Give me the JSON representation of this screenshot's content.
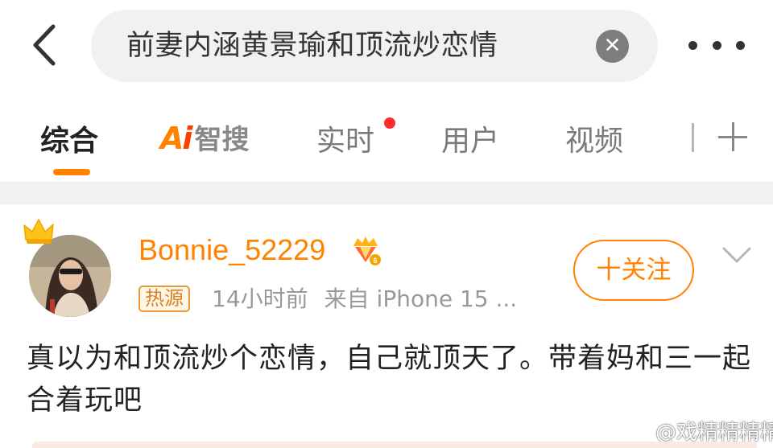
{
  "search": {
    "query": "前妻内涵黄景瑜和顶流炒恋情"
  },
  "tabs": [
    {
      "label": "综合",
      "active": true
    },
    {
      "label": "智搜",
      "logo_mark": "Ai"
    },
    {
      "label": "实时",
      "has_notification_dot": true
    },
    {
      "label": "用户"
    },
    {
      "label": "视频"
    }
  ],
  "post": {
    "username": "Bonnie_52229",
    "badge": "热源",
    "time": "14小时前",
    "source": "来自 iPhone 15 ...",
    "follow_label": "十关注",
    "body": "真以为和顶流炒个恋情，自己就顶天了。带着妈和三一起合着玩吧"
  },
  "watermark": {
    "text": "@戏精精精精"
  },
  "icons": {
    "back": "chevron-left-icon",
    "clear": "clear-x-icon",
    "more": "more-dots-icon",
    "add_tab": "plus-icon",
    "crown": "crown-icon",
    "vip": "vip-diamond-icon",
    "dropdown": "chevron-down-icon",
    "watermark_logo": "weibo-logo-icon"
  },
  "colors": {
    "accent": "#ff8200",
    "notification": "#ff2a2a",
    "search_bg": "#f1f1f1",
    "section_gap": "#f2f2f2"
  }
}
